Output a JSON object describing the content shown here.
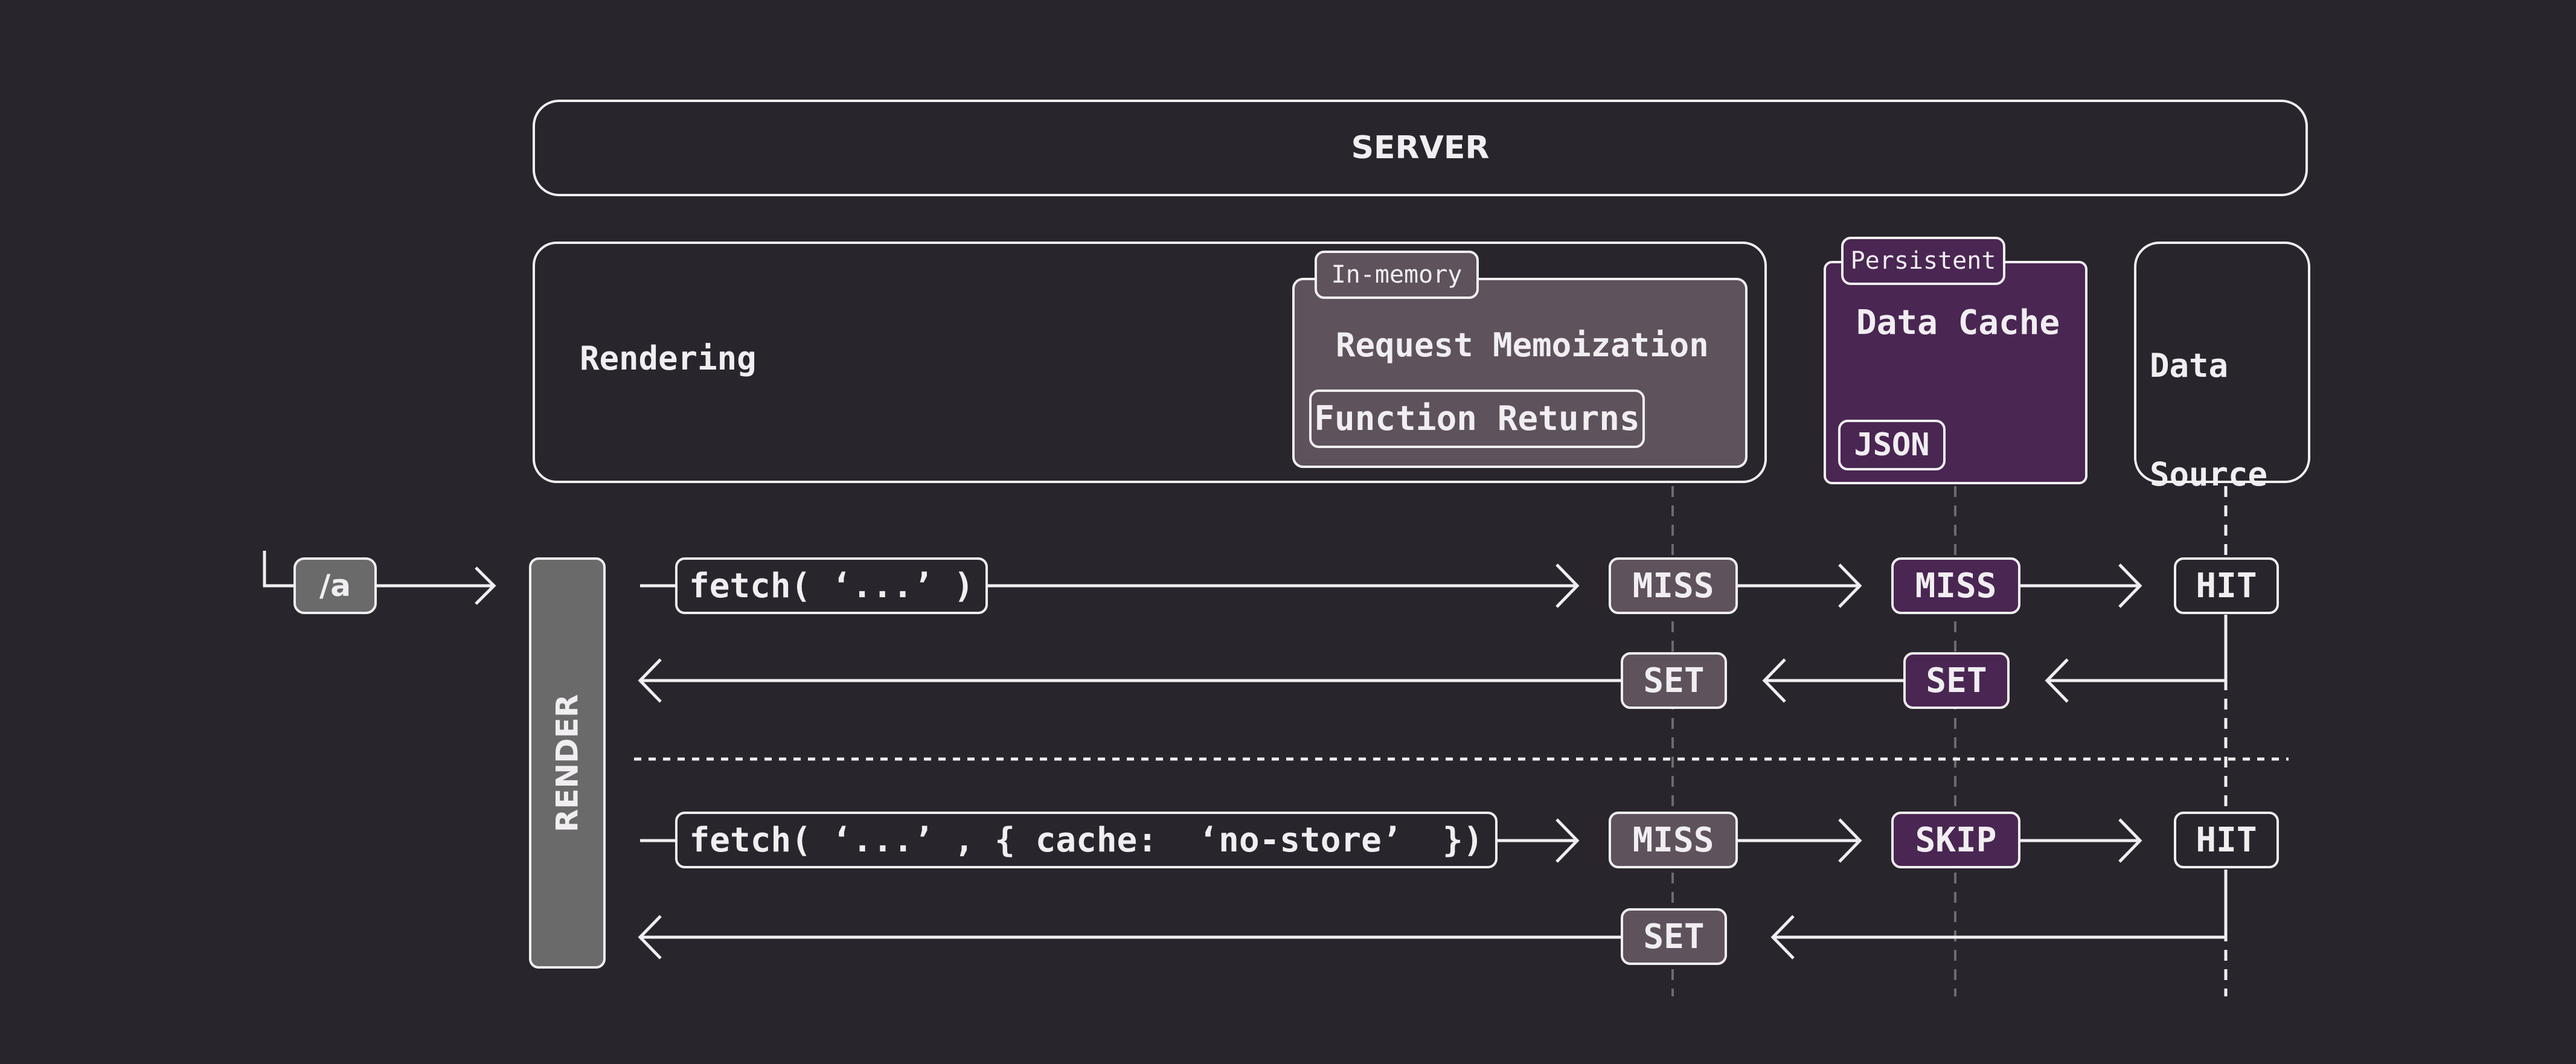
{
  "colors": {
    "background": "#29252c",
    "stroke": "#f1eef2",
    "memo_fill": "#5e525c",
    "cache_fill": "#4a2652",
    "render_fill": "#6a6a6a",
    "dashed_line": "#6d6a70"
  },
  "server": {
    "label": "SERVER"
  },
  "rendering": {
    "label": "Rendering"
  },
  "memoization": {
    "tag": "In-memory",
    "title": "Request Memoization",
    "content": "Function Returns"
  },
  "data_cache": {
    "tag": "Persistent",
    "title": "Data Cache",
    "content": "JSON"
  },
  "data_source": {
    "title_line1": "Data",
    "title_line2": "Source"
  },
  "route": {
    "label": "/a"
  },
  "render_bar": {
    "label": "RENDER"
  },
  "flows": [
    {
      "request": "fetch( ‘...’ )",
      "memo_status": "MISS",
      "cache_status": "MISS",
      "source_status": "HIT",
      "return_memo": "SET",
      "return_cache": "SET"
    },
    {
      "request": "fetch( ‘...’ , { cache:  ‘no-store’  })",
      "memo_status": "MISS",
      "cache_status": "SKIP",
      "source_status": "HIT",
      "return_memo": "SET"
    }
  ]
}
